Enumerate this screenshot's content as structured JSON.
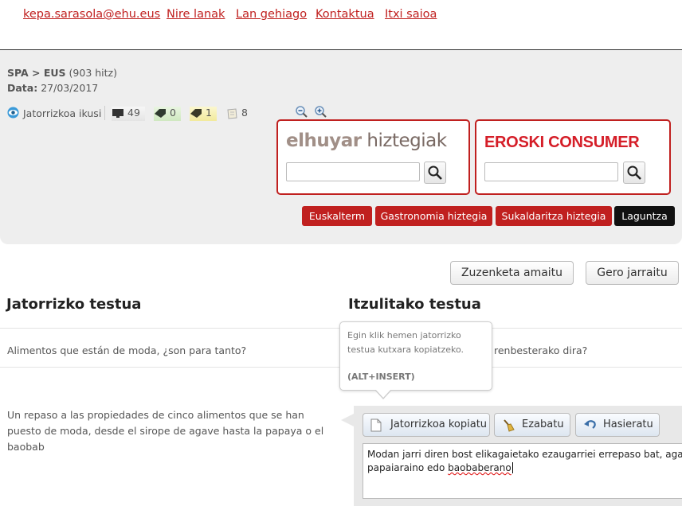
{
  "nav": {
    "email": "kepa.sarasola@ehu.eus",
    "my_works": "Nire lanak",
    "more_works": "Lan gehiago",
    "contact": "Kontaktua",
    "logout": "Itxi saioa"
  },
  "info": {
    "pair": "SPA > EUS",
    "word_count": "(903 hitz)",
    "date_label": "Data:",
    "date": "27/03/2017"
  },
  "stats": {
    "view_source": "Jatorrizkoa ikusi",
    "machine": "49",
    "green": "0",
    "yellow": "1",
    "notes": "8"
  },
  "dictionaries": {
    "elhuyar_bold": "elhuyar",
    "elhuyar_rest": " hiztegiak",
    "elhuyar_query": "",
    "eroski": "EROSKI CONSUMER",
    "eroski_query": ""
  },
  "tags": {
    "euskalterm": "Euskalterm",
    "gastro": "Gastronomia hiztegia",
    "sukaldaritza": "Sukaldaritza hiztegia",
    "help": "Laguntza"
  },
  "actions": {
    "finish": "Zuzenketa amaitu",
    "continue": "Gero jarraitu"
  },
  "headings": {
    "source": "Jatorrizko testua",
    "target": "Itzulitako testua"
  },
  "segments": {
    "source_1": "Alimentos que están de moda, ¿son para tanto?",
    "target_1_visible": "renbesterako dira?",
    "source_2": "Un repaso a las propiedades de cinco alimentos que se han puesto de moda, desde el sirope de agave hasta la papaya o el baobab",
    "target_2_line1": "Modan jarri diren bost elikagaietako ezaugarriei errepaso bat, agabezko",
    "target_2_line2_a": "papaiaraino edo ",
    "target_2_line2_b": "baobaberano"
  },
  "tooltip": {
    "text": "Egin klik hemen jatorrizko testua kutxara kopiatzeko.",
    "shortcut": "(ALT+INSERT)"
  },
  "editor": {
    "copy_source": "Jatorrizkoa kopiatu",
    "clear": "Ezabatu",
    "reset": "Hasieratu"
  },
  "colors": {
    "brand_red": "#c0201f",
    "panel_bg": "#eeeeee",
    "eroski_red": "#d51e28"
  }
}
